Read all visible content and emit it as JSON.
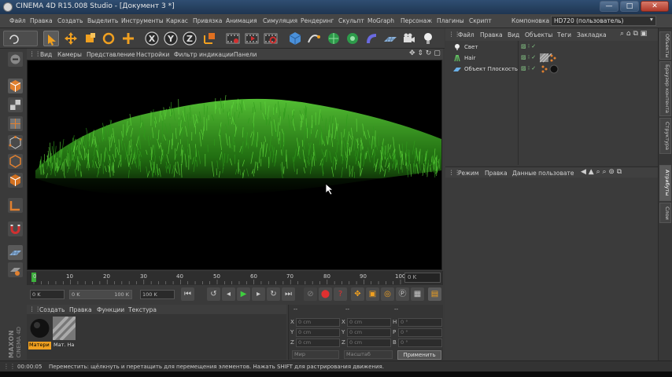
{
  "window": {
    "title": "CINEMA 4D R15.008 Studio - [Документ 3 *]",
    "minimize": "—",
    "maximize": "□",
    "close": "✕"
  },
  "menubar": {
    "items": [
      "Файл",
      "Правка",
      "Создать",
      "Выделить",
      "Инструменты",
      "Каркас",
      "Привязка",
      "Анимация",
      "Симуляция",
      "Рендеринг",
      "Скульпт",
      "MoGraph",
      "Персонаж",
      "Плагины",
      "Скрипт",
      "Компоновка"
    ],
    "layout_value": "HD720 (пользователь)"
  },
  "toolbar": {
    "axis_x": "X",
    "axis_y": "Y",
    "axis_z": "Z"
  },
  "viewport_menu": {
    "items": [
      "Вид",
      "Камеры",
      "Представление",
      "Настройки",
      "Фильтр индикации",
      "Панели"
    ]
  },
  "timeline": {
    "ticks": [
      "0",
      "10",
      "20",
      "30",
      "40",
      "50",
      "60",
      "70",
      "80",
      "90",
      "100"
    ],
    "frame_value": "0 K"
  },
  "playback": {
    "start_field": "0 K",
    "min_field": "0 K",
    "max_field": "100 K",
    "end_field": "100 K"
  },
  "materials": {
    "menu": [
      "Создать",
      "Правка",
      "Функции",
      "Текстура"
    ],
    "items": [
      {
        "label": "Матери"
      },
      {
        "label": "Мат. На"
      }
    ]
  },
  "coordinates": {
    "header_left": "--",
    "header_mid": "--",
    "header_right": "--",
    "rows": [
      {
        "a": "X",
        "a_val": "0 cm",
        "b": "X",
        "b_val": "0 cm",
        "c": "H",
        "c_val": "0 °"
      },
      {
        "a": "Y",
        "a_val": "0 cm",
        "b": "Y",
        "b_val": "0 cm",
        "c": "P",
        "c_val": "0 °"
      },
      {
        "a": "Z",
        "a_val": "0 cm",
        "b": "Z",
        "b_val": "0 cm",
        "c": "B",
        "c_val": "0 °"
      }
    ],
    "mode_select": "Мир",
    "scale_select": "Масштаб",
    "apply": "Применить"
  },
  "object_manager": {
    "menu": [
      "Файл",
      "Правка",
      "Вид",
      "Объекты",
      "Теги",
      "Закладка"
    ],
    "objects": [
      {
        "name": "Свет"
      },
      {
        "name": "Hair"
      },
      {
        "name": "Объект Плоскость"
      }
    ]
  },
  "attribute_manager": {
    "menu": [
      "Режим",
      "Правка",
      "Данные пользовате"
    ]
  },
  "right_tabs": [
    "Объекты",
    "Браузер контента",
    "Структура",
    "Атрибуты",
    "Слои"
  ],
  "status": {
    "time": "00:00:05",
    "message": "Переместить: щёлкнуть и перетащить для перемещения элементов. Нажать SHIFT для растрирования движения."
  },
  "brand": {
    "line1": "MAXON",
    "line2": "CINEMA 4D"
  },
  "colors": {
    "accent_orange": "#f0a020",
    "grass_green": "#2f9a1c",
    "play_green": "#3fcf3f",
    "record_red": "#e03030"
  }
}
